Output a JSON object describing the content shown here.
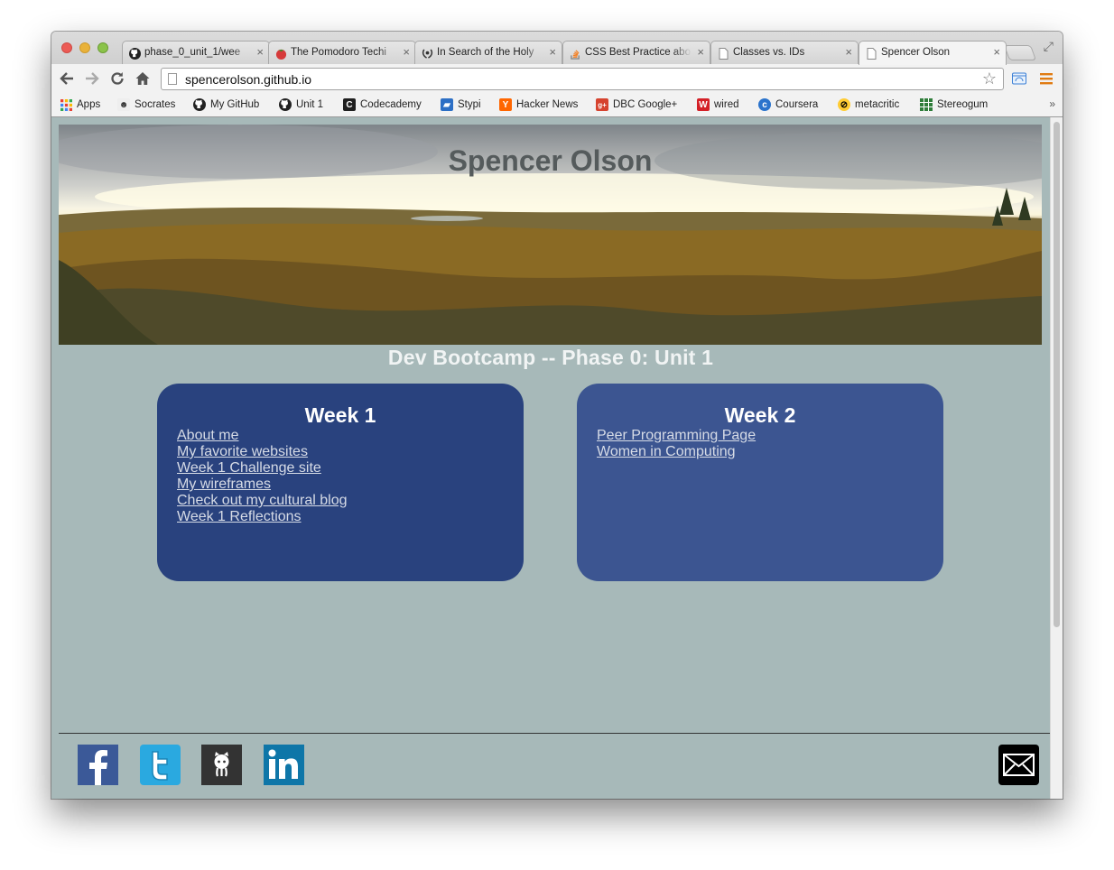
{
  "browser": {
    "tabs": [
      {
        "title": "phase_0_unit_1/wee",
        "icon": "github-icon",
        "active": false
      },
      {
        "title": "The Pomodoro Techi",
        "icon": "tomato-icon",
        "active": false
      },
      {
        "title": "In Search of the Holy",
        "icon": "laurel-icon",
        "active": false
      },
      {
        "title": "CSS Best Practice abo",
        "icon": "stackoverflow-icon",
        "active": false
      },
      {
        "title": "Classes vs. IDs",
        "icon": "page-icon",
        "active": false
      },
      {
        "title": "Spencer Olson",
        "icon": "page-icon",
        "active": true
      }
    ],
    "url": "spencerolson.github.io",
    "bookmarks": [
      {
        "label": "Apps",
        "icon": "apps-grid-icon"
      },
      {
        "label": "Socrates",
        "icon": "socrates-icon"
      },
      {
        "label": "My GitHub",
        "icon": "github-icon"
      },
      {
        "label": "Unit 1",
        "icon": "github-icon"
      },
      {
        "label": "Codecademy",
        "icon": "codecademy-icon"
      },
      {
        "label": "Stypi",
        "icon": "stypi-icon"
      },
      {
        "label": "Hacker News",
        "icon": "hacker-news-icon"
      },
      {
        "label": "DBC Google+",
        "icon": "google-plus-icon"
      },
      {
        "label": "wired",
        "icon": "wired-icon"
      },
      {
        "label": "Coursera",
        "icon": "coursera-icon"
      },
      {
        "label": "metacritic",
        "icon": "metacritic-icon"
      },
      {
        "label": "Stereogum",
        "icon": "stereogum-icon"
      }
    ]
  },
  "page": {
    "site_title": "Spencer Olson",
    "subtitle": "Dev Bootcamp -- Phase 0: Unit 1",
    "weeks": [
      {
        "heading": "Week 1",
        "links": [
          "About me",
          "My favorite websites",
          "Week 1 Challenge site",
          "My wireframes",
          "Check out my cultural blog",
          "Week 1 Reflections"
        ]
      },
      {
        "heading": "Week 2",
        "links": [
          "Peer Programming Page",
          "Women in Computing"
        ]
      }
    ],
    "social": [
      "facebook-icon",
      "twitter-icon",
      "github-octocat-icon",
      "linkedin-icon",
      "mail-icon"
    ]
  },
  "colors": {
    "page_background": "#a7b9b9",
    "week1_card": "#29427e",
    "week2_card": "#3c5591",
    "link": "#d6dbe6"
  }
}
